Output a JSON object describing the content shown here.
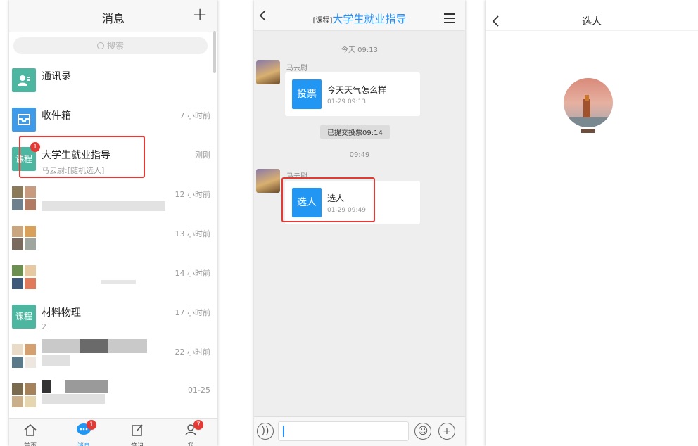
{
  "messages_screen": {
    "title": "消息",
    "add_icon": "plus-icon",
    "search_placeholder": "搜索",
    "items": [
      {
        "name": "通讯录",
        "sub": "",
        "time": ""
      },
      {
        "name": "收件箱",
        "sub": "",
        "time": "7 小时前"
      },
      {
        "avatar_text": "课程",
        "badge": "1",
        "name": "大学生就业指导",
        "sub": "马云尉:[随机选人]",
        "time": "刚刚"
      },
      {
        "name": "",
        "sub": "",
        "time": "12 小时前"
      },
      {
        "name": "",
        "sub": "",
        "time": "13 小时前"
      },
      {
        "name": "",
        "sub": "",
        "time": "14 小时前"
      },
      {
        "avatar_text": "课程",
        "name": "材料物理",
        "sub": "2",
        "time": "17 小时前"
      },
      {
        "name": "",
        "sub": "",
        "time": "22 小时前"
      },
      {
        "name": "",
        "sub": "",
        "time": "01-25"
      }
    ],
    "tabs": [
      {
        "label": "首页",
        "icon": "home-icon"
      },
      {
        "label": "消息",
        "icon": "chat-icon",
        "badge": "1"
      },
      {
        "label": "笔记",
        "icon": "note-icon"
      },
      {
        "label": "我",
        "icon": "person-icon",
        "badge": "7"
      }
    ]
  },
  "chat_screen": {
    "title_tag": "[课程]",
    "title": "大学生就业指导",
    "stamp1": "今天 09:13",
    "sender1": "马云尉",
    "card1_icon": "投票",
    "card1_title": "今天天气怎么样",
    "card1_time": "01-29 09:13",
    "notice": "已提交投票09:14",
    "stamp2": "09:49",
    "sender2": "马云尉",
    "card2_icon": "选人",
    "card2_title": "选人",
    "card2_time": "01-29 09:49",
    "input_value": "",
    "emoji_icon": "emoji-icon",
    "more_icon": "plus-circle-icon",
    "voice_icon": "voice-icon"
  },
  "pick_screen": {
    "title": "选人"
  },
  "colors": {
    "accent_blue": "#2196f3",
    "course_green": "#4db6a0",
    "badge_red": "#e53935",
    "highlight_red": "#e53935"
  }
}
